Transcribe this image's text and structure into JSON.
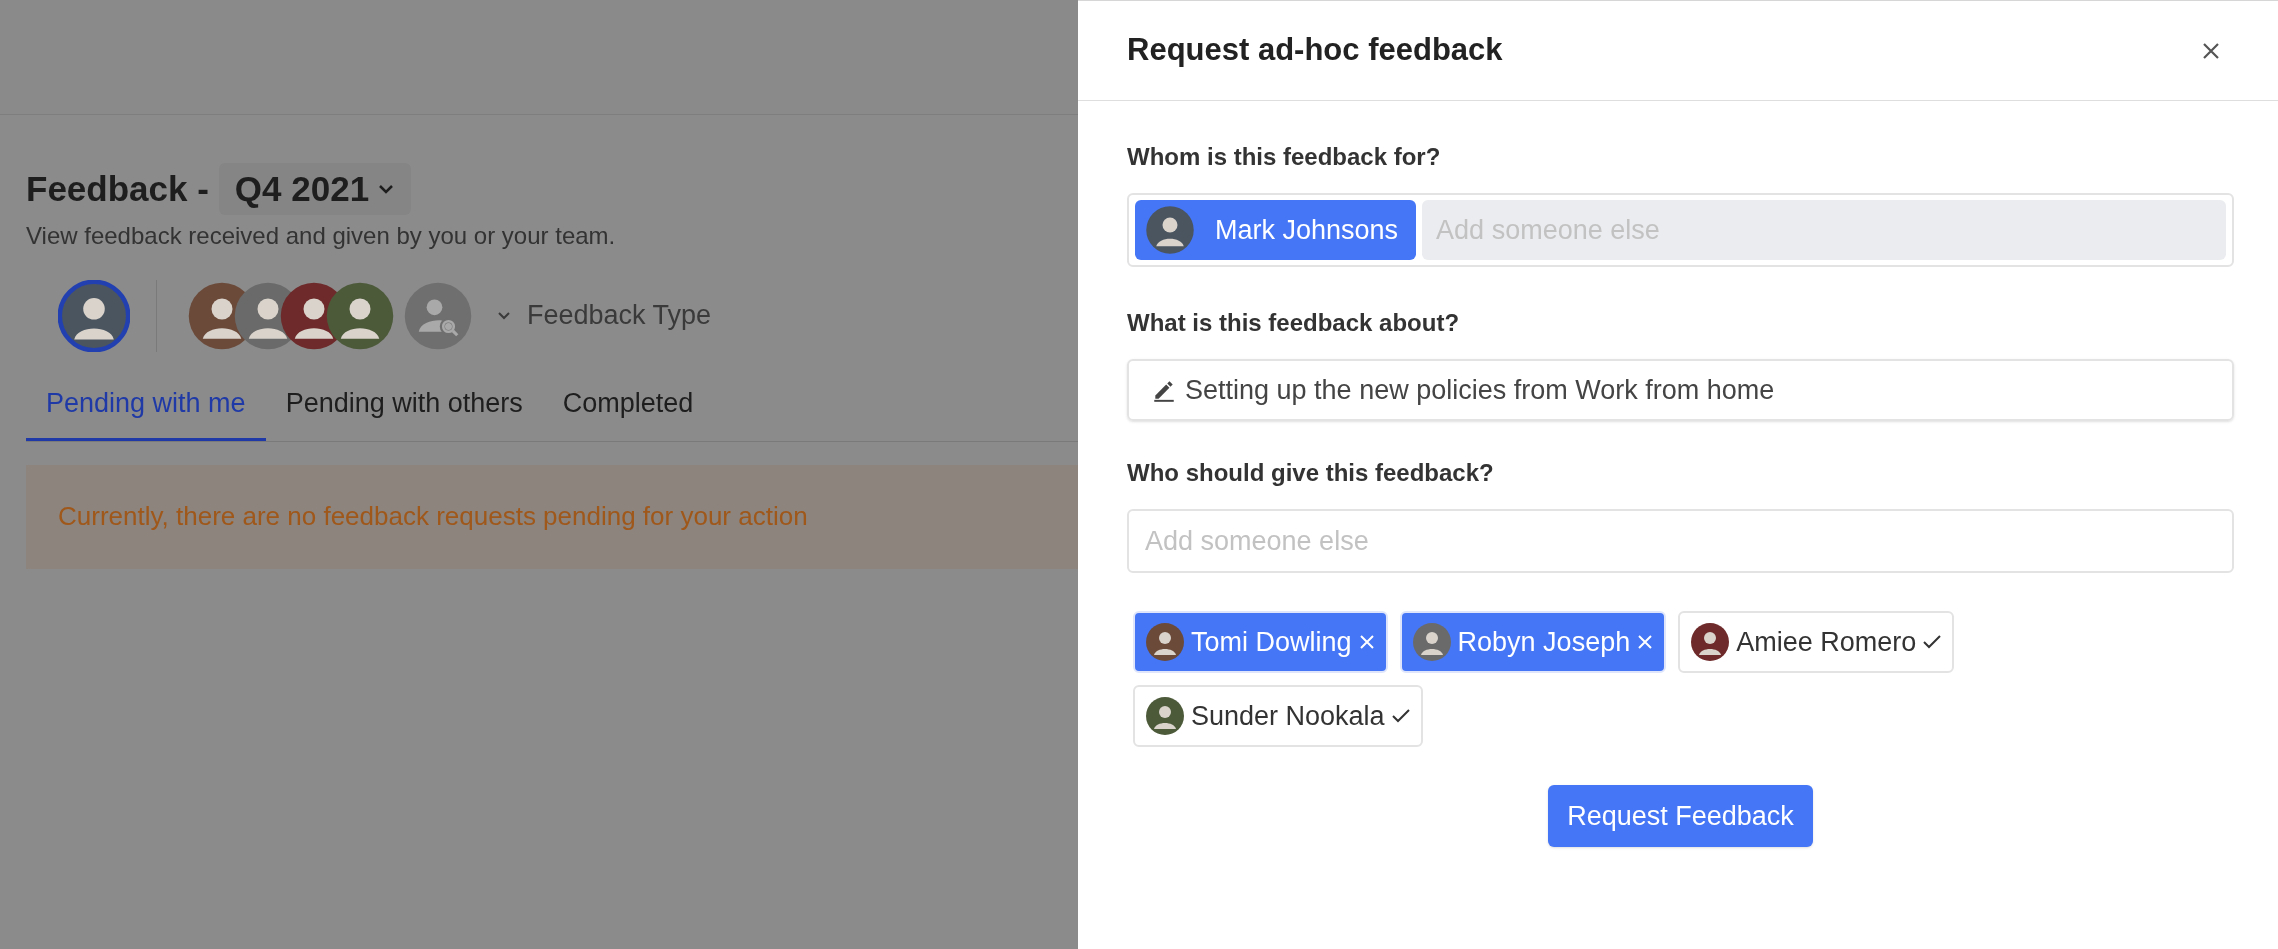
{
  "page": {
    "title": "Feedback -",
    "period": "Q4 2021",
    "subtitle": "View feedback received and given by you or your team.",
    "people": [
      {
        "selected": true
      },
      {
        "selected": false
      },
      {
        "selected": false
      },
      {
        "selected": false
      },
      {
        "selected": false
      }
    ],
    "filter": "Feedback Type",
    "tabs": [
      {
        "label": "Pending with me",
        "selected": true
      },
      {
        "label": "Pending with others",
        "selected": false
      },
      {
        "label": "Completed",
        "selected": false
      }
    ],
    "alert": "Currently, there are no feedback requests pending for your action"
  },
  "panel": {
    "title": "Request ad-hoc feedback",
    "for": {
      "label": "Whom is this feedback for?",
      "chip": "Mark Johnsons",
      "placeholder": "Add someone else"
    },
    "about": {
      "label": "What is this feedback about?",
      "value": "Setting up the new policies from Work from home"
    },
    "givers": {
      "label": "Who should give this feedback?",
      "placeholder": "Add someone else",
      "chips": [
        {
          "name": "Tomi Dowling",
          "selected": true
        },
        {
          "name": "Robyn Joseph",
          "selected": true
        },
        {
          "name": "Amiee Romero",
          "selected": false
        },
        {
          "name": "Sunder Nookala",
          "selected": false
        }
      ]
    },
    "button": "Request Feedback"
  }
}
